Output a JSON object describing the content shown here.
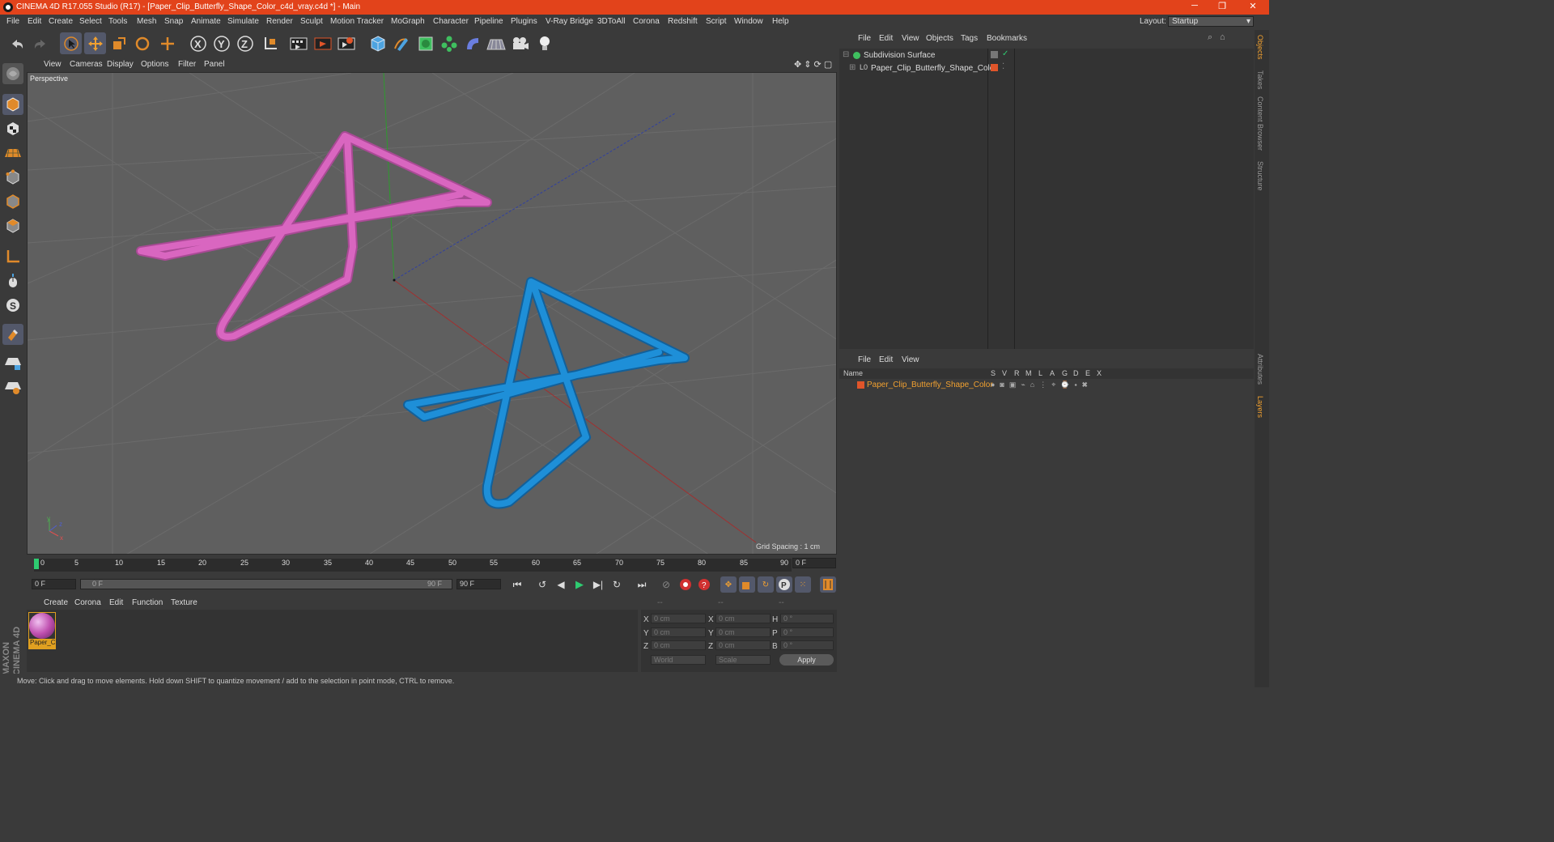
{
  "app": {
    "title": "CINEMA 4D R17.055 Studio (R17) - [Paper_Clip_Butterfly_Shape_Color_c4d_vray.c4d *] - Main",
    "layout_label": "Layout:",
    "layout_value": "Startup"
  },
  "menu": [
    "File",
    "Edit",
    "Create",
    "Select",
    "Tools",
    "Mesh",
    "Snap",
    "Animate",
    "Simulate",
    "Render",
    "Sculpt",
    "Motion Tracker",
    "MoGraph",
    "Character",
    "Pipeline",
    "Plugins",
    "V-Ray Bridge",
    "3DToAll",
    "Corona",
    "Redshift",
    "Script",
    "Window",
    "Help"
  ],
  "viewport": {
    "menu": [
      "View",
      "Cameras",
      "Display",
      "Options",
      "Filter",
      "Panel"
    ],
    "label": "Perspective",
    "grid_spacing": "Grid Spacing : 1 cm",
    "colors": {
      "pink": "#d966c0",
      "blue": "#1e8fd8"
    }
  },
  "timeline": {
    "ticks": [
      "0",
      "5",
      "10",
      "15",
      "20",
      "25",
      "30",
      "35",
      "40",
      "45",
      "50",
      "55",
      "60",
      "65",
      "70",
      "75",
      "80",
      "85",
      "90"
    ],
    "end_field": "0 F",
    "start": "0 F",
    "range_start": "0 F",
    "range_end": "90 F",
    "end": "90 F"
  },
  "material": {
    "menu": [
      "Create",
      "Corona",
      "Edit",
      "Function",
      "Texture"
    ],
    "name": "Paper_C"
  },
  "coords": {
    "header": [
      "--",
      "--",
      "--"
    ],
    "rows": [
      {
        "a": "X",
        "av": "0 cm",
        "b": "X",
        "bv": "0 cm",
        "c": "H",
        "cv": "0 °"
      },
      {
        "a": "Y",
        "av": "0 cm",
        "b": "Y",
        "bv": "0 cm",
        "c": "P",
        "cv": "0 °"
      },
      {
        "a": "Z",
        "av": "0 cm",
        "b": "Z",
        "bv": "0 cm",
        "c": "B",
        "cv": "0 °"
      }
    ],
    "world": "World",
    "scale": "Scale",
    "apply": "Apply"
  },
  "status": "Move: Click and drag to move elements. Hold down SHIFT to quantize movement / add to the selection in point mode, CTRL to remove.",
  "objects": {
    "menu": [
      "File",
      "Edit",
      "View",
      "Objects",
      "Tags",
      "Bookmarks"
    ],
    "items": [
      "Subdivision Surface",
      "Paper_Clip_Butterfly_Shape_Color"
    ]
  },
  "layers": {
    "menu": [
      "File",
      "Edit",
      "View"
    ],
    "header_name": "Name",
    "cols": [
      "S",
      "V",
      "R",
      "M",
      "L",
      "A",
      "G",
      "D",
      "E",
      "X"
    ],
    "item": "Paper_Clip_Butterfly_Shape_Color"
  },
  "sidetabs": [
    "Objects",
    "Takes",
    "Content Browser",
    "Structure",
    "Attributes",
    "Layers"
  ],
  "brand": "MAXON CINEMA 4D"
}
